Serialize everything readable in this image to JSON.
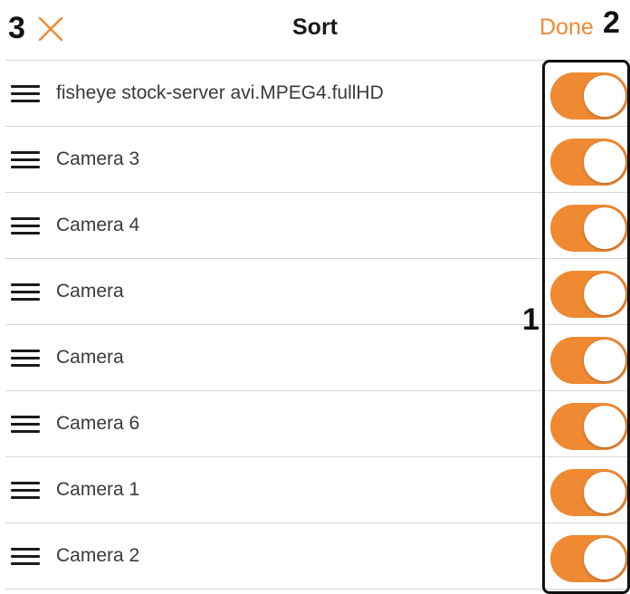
{
  "header": {
    "title": "Sort",
    "done_label": "Done",
    "close_icon": "close-icon"
  },
  "callouts": {
    "one": "1",
    "two": "2",
    "three": "3"
  },
  "colors": {
    "accent": "#ef8a33",
    "text": "#3a3a3a",
    "divider": "#d6d6d6"
  },
  "rows": [
    {
      "label": "fisheye stock-server avi.MPEG4.fullHD",
      "enabled": true
    },
    {
      "label": "Camera 3",
      "enabled": true
    },
    {
      "label": "Camera 4",
      "enabled": true
    },
    {
      "label": "Camera",
      "enabled": true
    },
    {
      "label": "Camera",
      "enabled": true
    },
    {
      "label": "Camera 6",
      "enabled": true
    },
    {
      "label": "Camera 1",
      "enabled": true
    },
    {
      "label": "Camera 2",
      "enabled": true
    }
  ]
}
